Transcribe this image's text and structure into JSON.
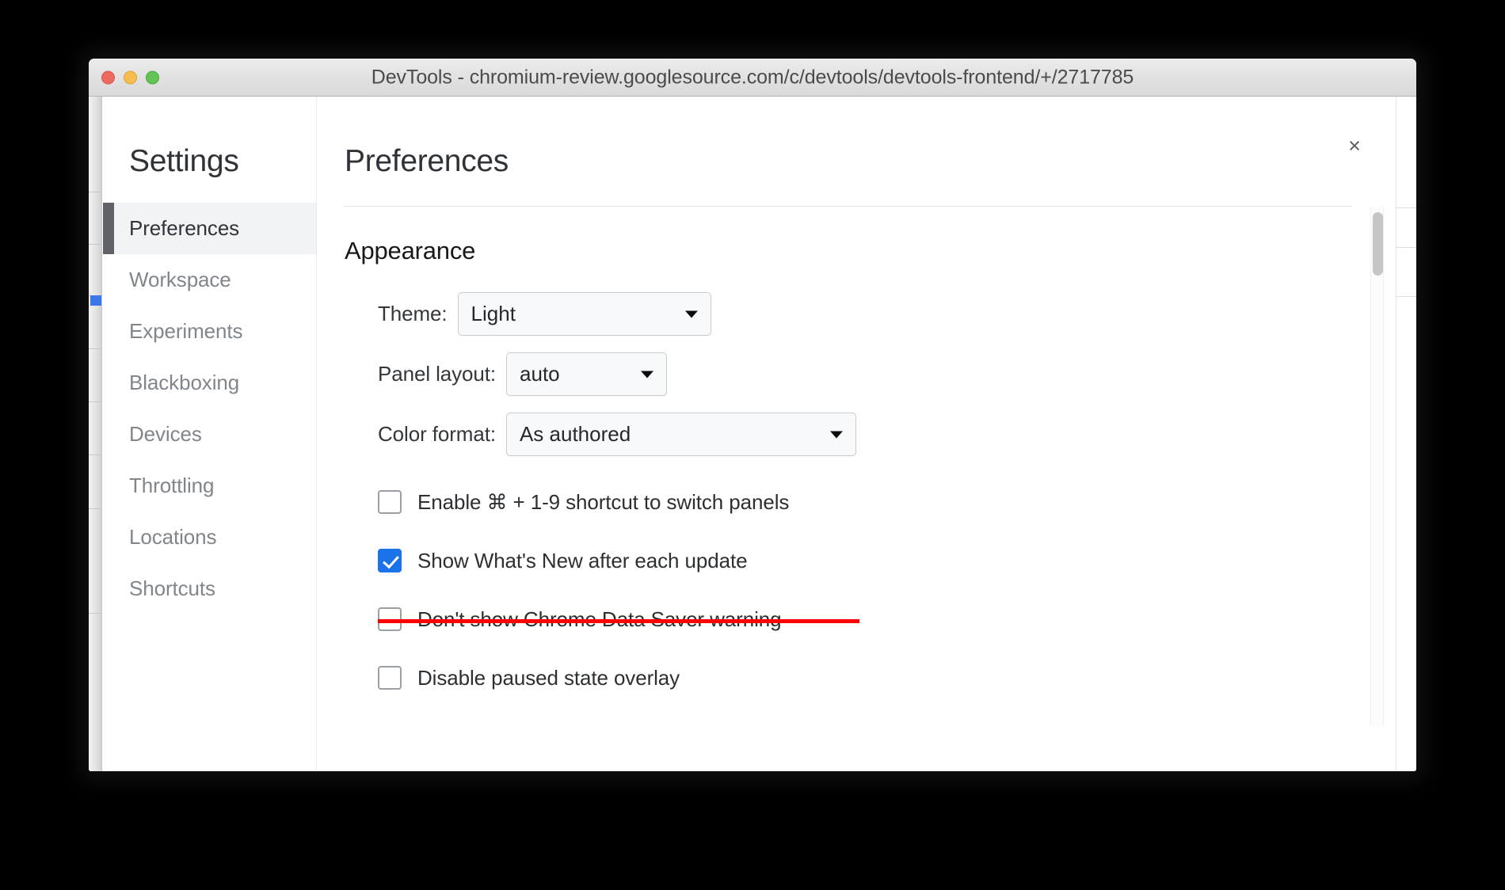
{
  "window": {
    "title": "DevTools - chromium-review.googlesource.com/c/devtools/devtools-frontend/+/2717785",
    "traffic_lights": {
      "close_color": "#ee6a5f",
      "minimize_color": "#f5bd4f",
      "maximize_color": "#61c454"
    }
  },
  "dialog": {
    "close_label": "×",
    "sidebar": {
      "title": "Settings",
      "items": [
        {
          "label": "Preferences",
          "selected": true
        },
        {
          "label": "Workspace",
          "selected": false
        },
        {
          "label": "Experiments",
          "selected": false
        },
        {
          "label": "Blackboxing",
          "selected": false
        },
        {
          "label": "Devices",
          "selected": false
        },
        {
          "label": "Throttling",
          "selected": false
        },
        {
          "label": "Locations",
          "selected": false
        },
        {
          "label": "Shortcuts",
          "selected": false
        }
      ]
    },
    "main": {
      "title": "Preferences",
      "section_heading": "Appearance",
      "selects": [
        {
          "label": "Theme:",
          "value": "Light",
          "arrow": "chevron-down-icon"
        },
        {
          "label": "Panel layout:",
          "value": "auto",
          "arrow": "chevron-down-icon"
        },
        {
          "label": "Color format:",
          "value": "As authored",
          "arrow": "chevron-down-icon"
        }
      ],
      "checkboxes": [
        {
          "label": "Enable ⌘ + 1-9 shortcut to switch panels",
          "checked": false,
          "struck": false
        },
        {
          "label": "Show What's New after each update",
          "checked": true,
          "struck": false
        },
        {
          "label": "Don't show Chrome Data Saver warning",
          "checked": false,
          "struck": true
        },
        {
          "label": "Disable paused state overlay",
          "checked": false,
          "struck": false
        }
      ]
    }
  },
  "colors": {
    "accent_checkbox": "#1a73e8",
    "strikethrough": "#fe0000",
    "selected_indicator": "#5f6368",
    "selected_row_bg": "#f1f3f4",
    "strip_marker": "#3b77e8"
  }
}
